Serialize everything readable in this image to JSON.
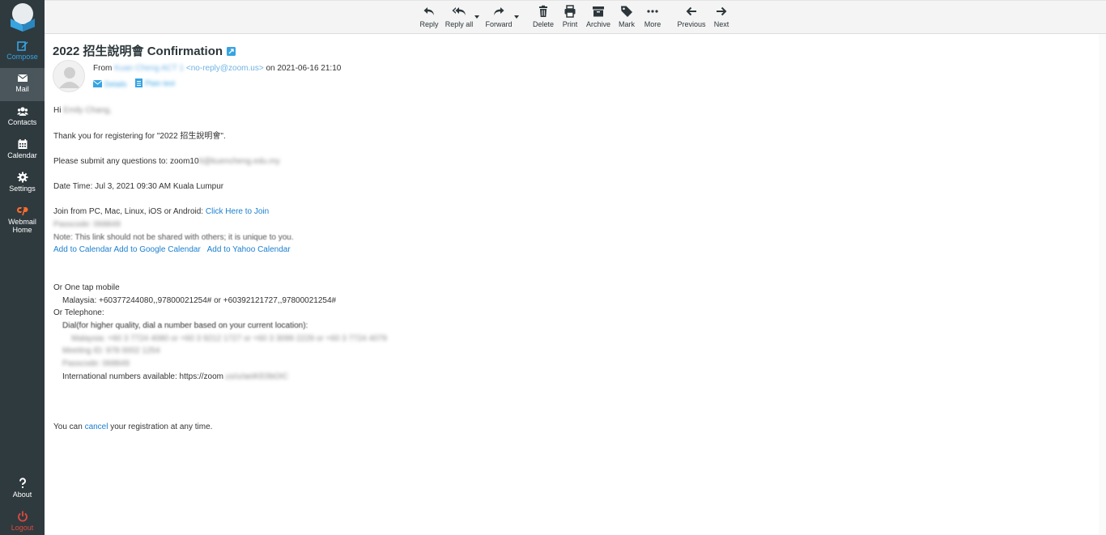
{
  "sidebar": {
    "compose": "Compose",
    "mail": "Mail",
    "contacts": "Contacts",
    "calendar": "Calendar",
    "settings": "Settings",
    "webmail_line1": "Webmail",
    "webmail_line2": "Home",
    "about": "About",
    "logout": "Logout"
  },
  "toolbar": {
    "reply": "Reply",
    "reply_all": "Reply all",
    "forward": "Forward",
    "delete": "Delete",
    "print": "Print",
    "archive": "Archive",
    "mark": "Mark",
    "more": "More",
    "previous": "Previous",
    "next": "Next"
  },
  "message": {
    "subject": "2022 招生說明會 Confirmation",
    "from_label": "From",
    "from_name": "Kuan Cheng ACT 1",
    "from_email": "<no-reply@zoom.us>",
    "date_prefix": "on",
    "date": "2021-06-16 21:10",
    "details_link": "Details",
    "plaintext_link": "Plain text"
  },
  "body": {
    "greeting_prefix": "Hi",
    "greeting_name": "Emily Chang,",
    "thanks": "Thank you for registering for \"2022 招生說明會\".",
    "questions_prefix": "Please submit any questions to: zoom10",
    "questions_email_blur": "6@kuencheng.edu.my",
    "datetime": "Date Time: Jul 3, 2021 09:30 AM Kuala Lumpur",
    "join_prefix": "Join from PC, Mac, Linux, iOS or Android:",
    "join_link": "Click Here to Join",
    "passcode_blur": "Passcode: 068849",
    "note_blur": "Note: This link should not be shared with others; it is unique to you.",
    "add_calendar": "Add to Calendar",
    "add_google": "Add to Google Calendar",
    "add_yahoo": "Add to Yahoo Calendar",
    "one_tap": "Or One tap mobile",
    "malaysia_tap": "Malaysia: +60377244080,,97800021254# or +60392121727,,97800021254#",
    "or_telephone": "Or Telephone:",
    "dial_hint": "Dial(for higher quality, dial a number based on your current location):",
    "malaysia_dial_blur": "Malaysia: +60 3 7724 4080 or +60 3 9212 1727 or +60 3 3099 2229 or +60 3 7724 4079",
    "meeting_id_blur": "Meeting ID: 978 0002 1254",
    "passcode2_blur": "Passcode: 068849",
    "intl_prefix": "International numbers available: https://zoom",
    "intl_blur": ".us/u/aeiKE0bOIC",
    "cancel_prefix": "You can",
    "cancel_link": "cancel",
    "cancel_suffix": "your registration at any time."
  },
  "colors": {
    "sidebar_bg": "#2f3a3f",
    "accent": "#37a4e2",
    "link": "#1b7fcf",
    "logout": "#e0493d"
  }
}
